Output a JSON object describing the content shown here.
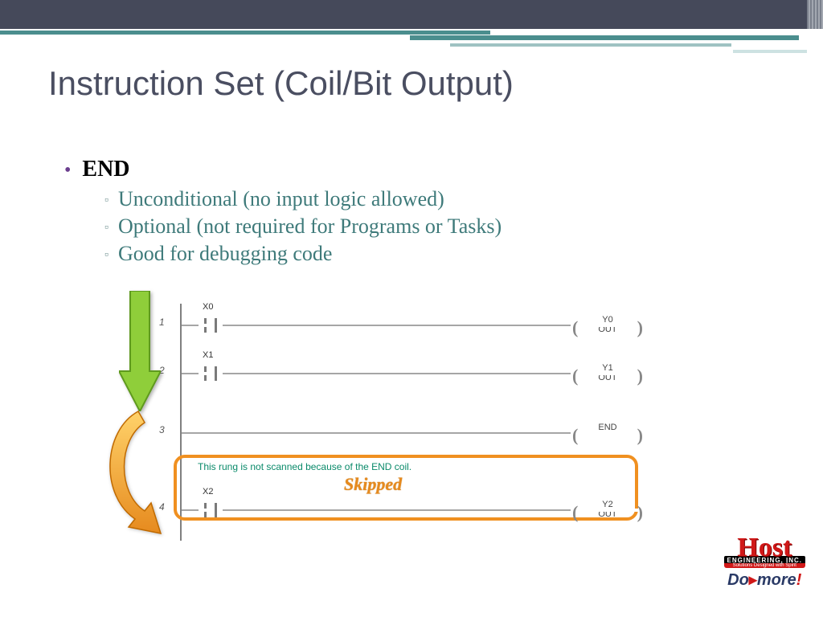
{
  "title": "Instruction Set (Coil/Bit Output)",
  "main_bullet": "END",
  "sub_bullets": [
    "Unconditional (no input logic allowed)",
    "Optional (not required for Programs or Tasks)",
    "Good for debugging code"
  ],
  "diagram": {
    "rungs": [
      {
        "num": "1",
        "contact": "X0",
        "coil_top": "Y0",
        "coil_bot": "OUT"
      },
      {
        "num": "2",
        "contact": "X1",
        "coil_top": "Y1",
        "coil_bot": "OUT"
      },
      {
        "num": "3",
        "contact": "",
        "coil_top": "",
        "coil_bot": "END"
      },
      {
        "num": "4",
        "contact": "X2",
        "coil_top": "Y2",
        "coil_bot": "OUT"
      }
    ],
    "skip_message": "This rung is not scanned because of the END coil.",
    "skipped_label": "Skipped"
  },
  "logo": {
    "brand": "Host",
    "subtitle": "ENGINEERING, INC.",
    "tagline": "Solutions Designed with Spirit",
    "product_a": "Do",
    "product_b": "more",
    "excl": "!"
  }
}
